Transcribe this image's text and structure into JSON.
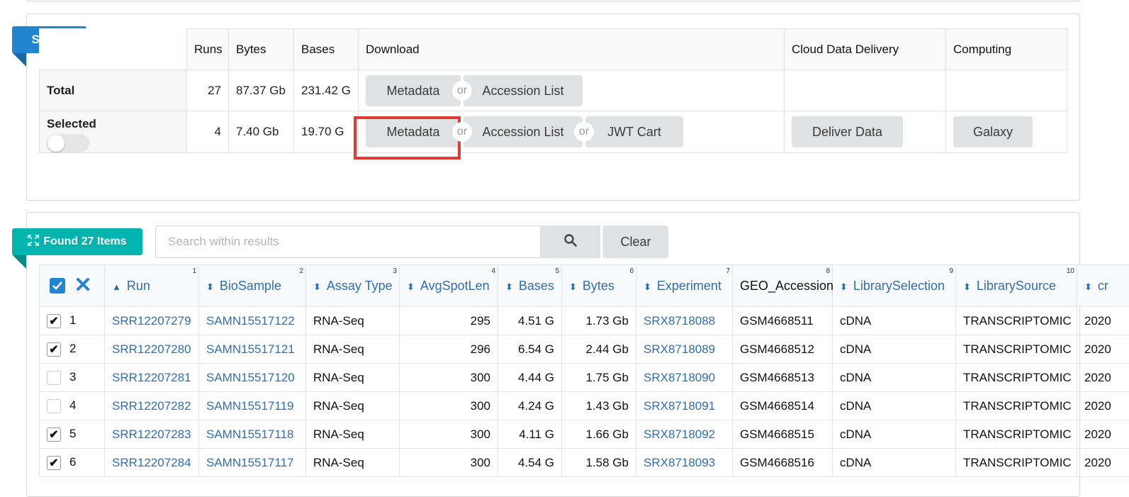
{
  "select_panel": {
    "ribbon_label": "Select",
    "headers": [
      "Runs",
      "Bytes",
      "Bases",
      "Download",
      "Cloud Data Delivery",
      "Computing"
    ],
    "total": {
      "label": "Total",
      "runs": "27",
      "bytes": "87.37 Gb",
      "bases": "231.42 G",
      "metadata": "Metadata",
      "or": "or",
      "accession_list": "Accession List"
    },
    "selected": {
      "label": "Selected",
      "runs": "4",
      "bytes": "7.40 Gb",
      "bases": "19.70 G",
      "metadata": "Metadata",
      "or1": "or",
      "accession_list": "Accession List",
      "or2": "or",
      "jwt_cart": "JWT Cart",
      "deliver_data": "Deliver Data",
      "galaxy": "Galaxy",
      "toggle_on": false
    }
  },
  "results_panel": {
    "ribbon_label": "Found 27 Items",
    "search_placeholder": "Search within results",
    "clear_label": "Clear",
    "columns": [
      {
        "label": "Run",
        "index": "1",
        "sort": "▲"
      },
      {
        "label": "BioSample",
        "index": "2",
        "sort": "⬍"
      },
      {
        "label": "Assay Type",
        "index": "3",
        "sort": "⬍"
      },
      {
        "label": "AvgSpotLen",
        "index": "4",
        "sort": "⬍"
      },
      {
        "label": "Bases",
        "index": "5",
        "sort": "⬍"
      },
      {
        "label": "Bytes",
        "index": "6",
        "sort": "⬍"
      },
      {
        "label": "Experiment",
        "index": "7",
        "sort": "⬍"
      },
      {
        "label": "GEO_Accession",
        "index": "8",
        "sort": ""
      },
      {
        "label": "LibrarySelection",
        "index": "9",
        "sort": "⬍"
      },
      {
        "label": "LibrarySource",
        "index": "10",
        "sort": "⬍"
      },
      {
        "label": "cr",
        "index": "",
        "sort": "⬍"
      }
    ],
    "rows": [
      {
        "n": "1",
        "checked": true,
        "run": "SRR12207279",
        "biosample": "SAMN15517122",
        "assay": "RNA-Seq",
        "avgspotlen": "295",
        "bases": "4.51 G",
        "bytes": "1.73 Gb",
        "experiment": "SRX8718088",
        "geo": "GSM4668511",
        "libsel": "cDNA",
        "libsrc": "TRANSCRIPTOMIC",
        "created": "2020"
      },
      {
        "n": "2",
        "checked": true,
        "run": "SRR12207280",
        "biosample": "SAMN15517121",
        "assay": "RNA-Seq",
        "avgspotlen": "296",
        "bases": "6.54 G",
        "bytes": "2.44 Gb",
        "experiment": "SRX8718089",
        "geo": "GSM4668512",
        "libsel": "cDNA",
        "libsrc": "TRANSCRIPTOMIC",
        "created": "2020"
      },
      {
        "n": "3",
        "checked": false,
        "run": "SRR12207281",
        "biosample": "SAMN15517120",
        "assay": "RNA-Seq",
        "avgspotlen": "300",
        "bases": "4.44 G",
        "bytes": "1.75 Gb",
        "experiment": "SRX8718090",
        "geo": "GSM4668513",
        "libsel": "cDNA",
        "libsrc": "TRANSCRIPTOMIC",
        "created": "2020"
      },
      {
        "n": "4",
        "checked": false,
        "run": "SRR12207282",
        "biosample": "SAMN15517119",
        "assay": "RNA-Seq",
        "avgspotlen": "300",
        "bases": "4.24 G",
        "bytes": "1.43 Gb",
        "experiment": "SRX8718091",
        "geo": "GSM4668514",
        "libsel": "cDNA",
        "libsrc": "TRANSCRIPTOMIC",
        "created": "2020"
      },
      {
        "n": "5",
        "checked": true,
        "run": "SRR12207283",
        "biosample": "SAMN15517118",
        "assay": "RNA-Seq",
        "avgspotlen": "300",
        "bases": "4.11 G",
        "bytes": "1.66 Gb",
        "experiment": "SRX8718092",
        "geo": "GSM4668515",
        "libsel": "cDNA",
        "libsrc": "TRANSCRIPTOMIC",
        "created": "2020"
      },
      {
        "n": "6",
        "checked": true,
        "run": "SRR12207284",
        "biosample": "SAMN15517117",
        "assay": "RNA-Seq",
        "avgspotlen": "300",
        "bases": "4.54 G",
        "bytes": "1.58 Gb",
        "experiment": "SRX8718093",
        "geo": "GSM4668516",
        "libsel": "cDNA",
        "libsrc": "TRANSCRIPTOMIC",
        "created": "2020"
      }
    ]
  },
  "colors": {
    "select_ribbon": "#2185d0",
    "found_ribbon": "#00b5ad",
    "link": "#2f6eb5",
    "highlight": "#e53935"
  }
}
